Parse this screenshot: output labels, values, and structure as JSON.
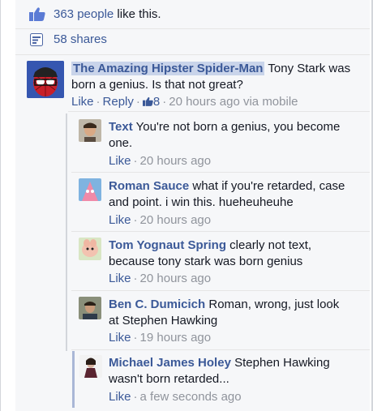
{
  "likes": {
    "count_text": "363 people",
    "suffix": " like this."
  },
  "shares": {
    "text": "58 shares"
  },
  "top_comment": {
    "author": "The Amazing Hipster Spider-Man",
    "text": "Tony Stark was born a genius. Is that not great?",
    "like_label": "Like",
    "reply_label": "Reply",
    "like_count": "8",
    "time": "20 hours ago via mobile"
  },
  "replies": [
    {
      "author": "Text",
      "text": "You're not born a genius, you become one.",
      "like_label": "Like",
      "time": "20 hours ago"
    },
    {
      "author": "Roman Sauce",
      "text": "what if you're retarded, case and point. i win this. hueheuheuhe",
      "like_label": "Like",
      "time": "20 hours ago"
    },
    {
      "author": "Tom Yognaut Spring",
      "text": "clearly not text, because tony stark was born genius",
      "like_label": "Like",
      "time": "20 hours ago"
    },
    {
      "author": "Ben C. Dumicich",
      "text": "Roman, wrong, just look at Stephen Hawking",
      "like_label": "Like",
      "time": "19 hours ago"
    },
    {
      "author": "Michael James Holey",
      "text": "Stephen Hawking wasn't born retarded...",
      "like_label": "Like",
      "time": "a few seconds ago"
    }
  ],
  "icons": {
    "like": "thumbs-up-icon",
    "shares": "share-icon",
    "like_count": "thumbs-up-small-icon"
  },
  "colors": {
    "link": "#3b5998",
    "meta": "#90949c",
    "background": "#f6f7f9",
    "highlight": "#c9d4ea"
  }
}
